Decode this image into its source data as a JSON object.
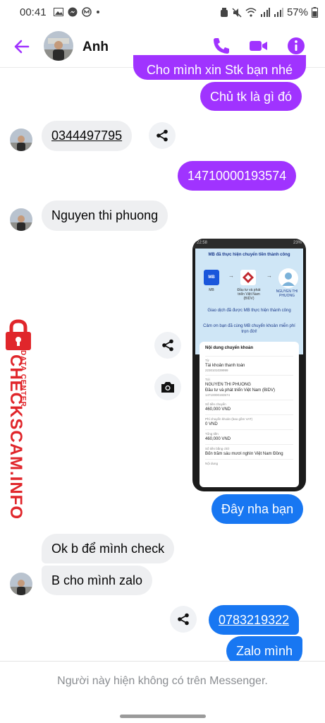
{
  "status_bar": {
    "time": "00:41",
    "battery": "57%"
  },
  "header": {
    "contact_name": "Anh",
    "icons": [
      "back-arrow-icon",
      "phone-icon",
      "video-camera-icon",
      "info-icon"
    ],
    "accent_color": "#a033ff"
  },
  "messages": {
    "cut_off_top": "Cho mình xin Stk bạn nhé",
    "m1": "Chủ tk là gì đó",
    "m2": "0344497795",
    "m3": "14710000193574",
    "m4": "Nguyen thi phuong",
    "m5": "Đây nha bạn",
    "m6": "Ok b để mình check",
    "m7": "B cho mình zalo",
    "m8": "0783219322",
    "m9": "Zalo mình"
  },
  "attachment": {
    "status_time": "22:58",
    "status_battery": "23%",
    "title": "MB đã thực hiện chuyển tiền thành công",
    "from_bank": "MB",
    "to_bank": "Đầu tư và phát triển Việt Nam (BIDV)",
    "recipient": "NGUYEN THI PHUONG",
    "desc1": "Giao dịch đã được MB thực hiện thành công",
    "desc2": "Cảm ơn bạn đã cùng MB chuyển khoản miễn phí trọn đời!",
    "card_title": "Nội dung chuyển khoản",
    "rows": [
      {
        "label": "Từ",
        "value": "Tài khoản thanh toán",
        "value2": "2230101039999"
      },
      {
        "label": "Tới",
        "value": "NGUYEN THI PHUONG",
        "value2": "Đầu tư và phát triển Việt Nam (BIDV)",
        "value3": "14710000193574"
      },
      {
        "label": "Số tiền chuyển",
        "value": "460,000 VND"
      },
      {
        "label": "Phí chuyển khoản (bao gồm VAT)",
        "value": "0 VND"
      },
      {
        "label": "Tổng tiền",
        "value": "460,000 VND"
      },
      {
        "label": "Số tiền bằng chữ",
        "value": "Bốn trăm sáu mươi nghìn Việt Nam Đồng"
      },
      {
        "label": "Nội dung",
        "value": ""
      }
    ]
  },
  "watermark": {
    "big": "CHECKSCAM.INFO",
    "small": "DATA CENTER"
  },
  "footer": {
    "text": "Người này hiện không có trên Messenger."
  }
}
